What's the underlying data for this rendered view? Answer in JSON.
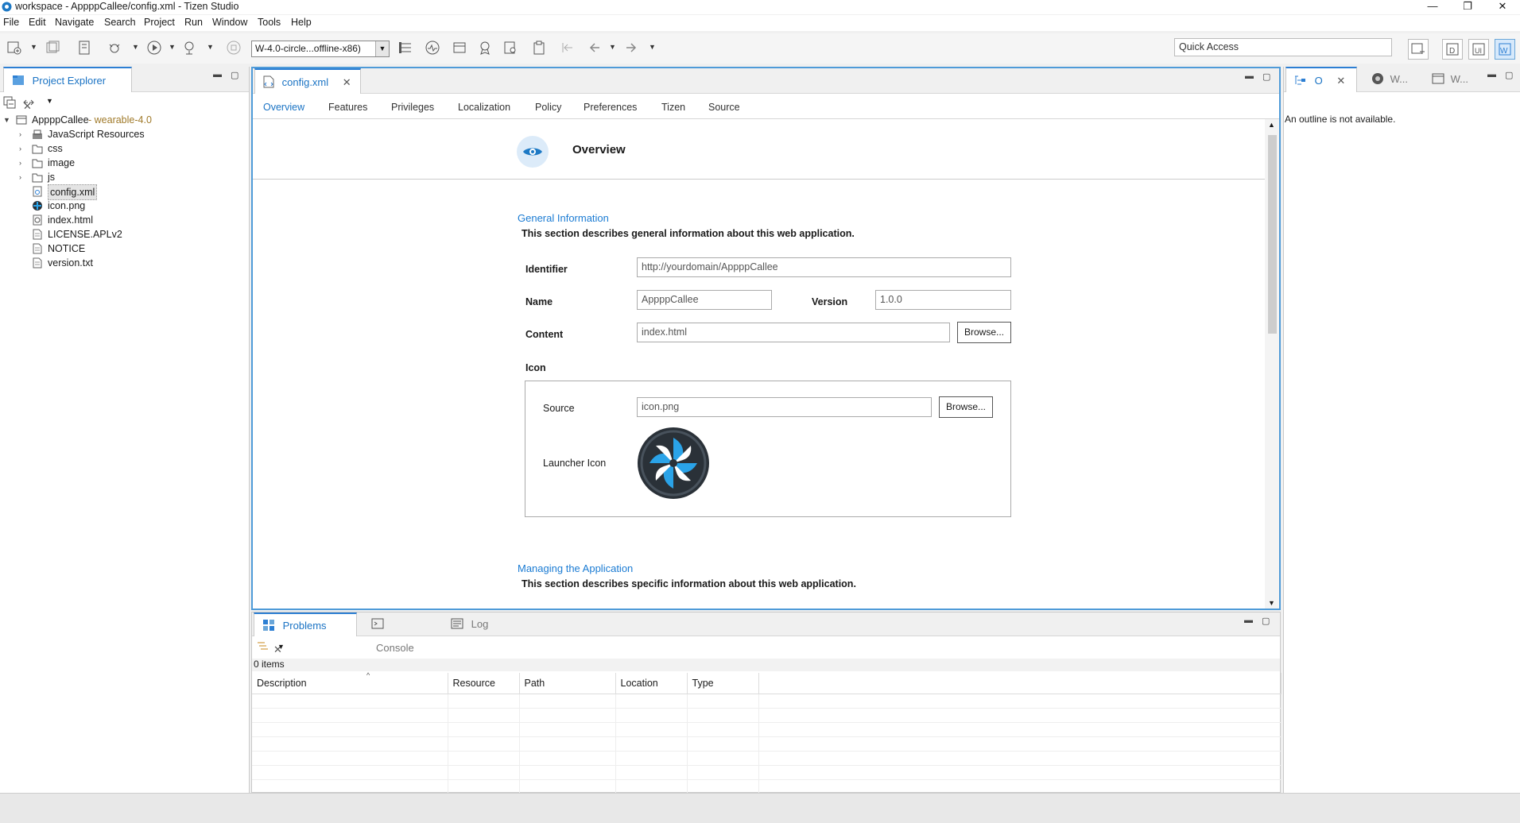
{
  "window": {
    "title": "workspace - AppppCallee/config.xml - Tizen Studio",
    "minimize": "—",
    "restore": "❐",
    "close": "✕"
  },
  "menu": [
    "File",
    "Edit",
    "Navigate",
    "Search",
    "Project",
    "Run",
    "Window",
    "Tools",
    "Help"
  ],
  "toolbar": {
    "device_combo": "W-4.0-circle...offline-x86)",
    "quick_access_placeholder": "Quick Access"
  },
  "explorer": {
    "tab_label": "Project Explorer",
    "project_name": "AppppCallee",
    "project_suffix": " - wearable-4.0",
    "items": [
      {
        "label": "JavaScript Resources",
        "type": "lib",
        "expandable": true
      },
      {
        "label": "css",
        "type": "folder",
        "expandable": true
      },
      {
        "label": "image",
        "type": "folder",
        "expandable": true
      },
      {
        "label": "js",
        "type": "folder",
        "expandable": true
      },
      {
        "label": "config.xml",
        "type": "config",
        "expandable": false
      },
      {
        "label": "icon.png",
        "type": "image",
        "expandable": false
      },
      {
        "label": "index.html",
        "type": "html",
        "expandable": false
      },
      {
        "label": "LICENSE.APLv2",
        "type": "file",
        "expandable": false
      },
      {
        "label": "NOTICE",
        "type": "file",
        "expandable": false
      },
      {
        "label": "version.txt",
        "type": "file",
        "expandable": false
      }
    ]
  },
  "editor": {
    "tab_label": "config.xml",
    "form_tabs": [
      "Overview",
      "Features",
      "Privileges",
      "Localization",
      "Policy",
      "Preferences",
      "Tizen",
      "Source"
    ],
    "page_title": "Overview",
    "general": {
      "title": "General Information",
      "desc": "This section describes general information about this web application.",
      "identifier_label": "Identifier",
      "identifier_value": "http://yourdomain/AppppCallee",
      "name_label": "Name",
      "name_value": "AppppCallee",
      "version_label": "Version",
      "version_value": "1.0.0",
      "content_label": "Content",
      "content_value": "index.html",
      "browse_label": "Browse...",
      "icon_label": "Icon",
      "source_label": "Source",
      "source_value": "icon.png",
      "launcher_label": "Launcher Icon"
    },
    "managing": {
      "title": "Managing the Application",
      "desc": "This section describes specific information about this web application."
    }
  },
  "outline": {
    "tabs": [
      "O",
      "W...",
      "W..."
    ],
    "message": "An outline is not available."
  },
  "bottom": {
    "tabs": [
      "Problems",
      "Console",
      "Log"
    ],
    "items_count": "0 items",
    "columns": [
      "Description",
      "Resource",
      "Path",
      "Location",
      "Type"
    ]
  },
  "colors": {
    "accent": "#2d7fd3",
    "section_title": "#1a7bd3"
  }
}
